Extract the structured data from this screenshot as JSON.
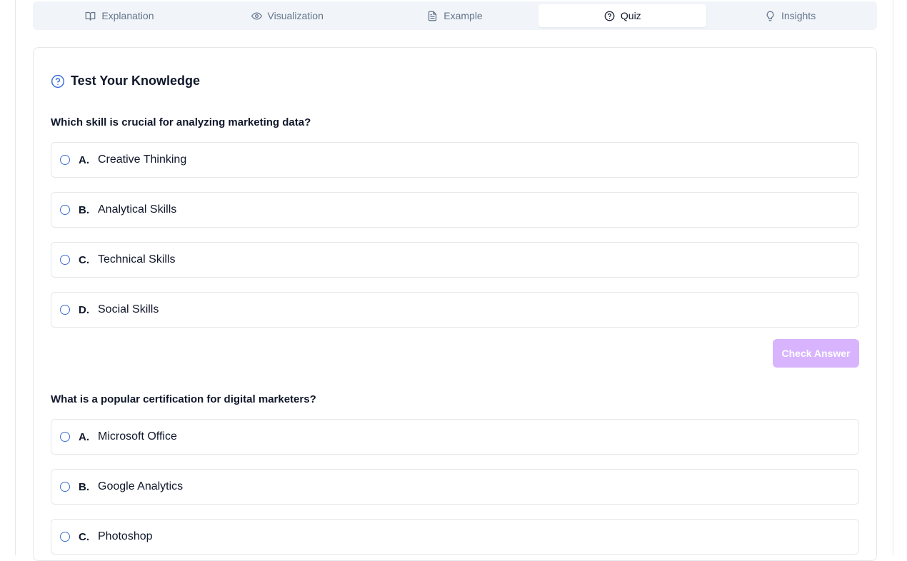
{
  "tabs": [
    {
      "label": "Explanation",
      "icon": "book-open-icon"
    },
    {
      "label": "Visualization",
      "icon": "eye-icon"
    },
    {
      "label": "Example",
      "icon": "file-text-icon"
    },
    {
      "label": "Quiz",
      "icon": "help-circle-icon",
      "active": true
    },
    {
      "label": "Insights",
      "icon": "lightbulb-icon"
    }
  ],
  "quiz": {
    "title": "Test Your Knowledge",
    "title_icon": "help-circle-icon",
    "accent_color": "#3b6fd8",
    "button_color": "#d8b4fe",
    "questions": [
      {
        "text": "Which skill is crucial for analyzing marketing data?",
        "options": [
          {
            "letter": "A.",
            "text": "Creative Thinking"
          },
          {
            "letter": "B.",
            "text": "Analytical Skills"
          },
          {
            "letter": "C.",
            "text": "Technical Skills"
          },
          {
            "letter": "D.",
            "text": "Social Skills"
          }
        ],
        "check_label": "Check Answer"
      },
      {
        "text": "What is a popular certification for digital marketers?",
        "options": [
          {
            "letter": "A.",
            "text": "Microsoft Office"
          },
          {
            "letter": "B.",
            "text": "Google Analytics"
          },
          {
            "letter": "C.",
            "text": "Photoshop"
          }
        ]
      }
    ]
  }
}
